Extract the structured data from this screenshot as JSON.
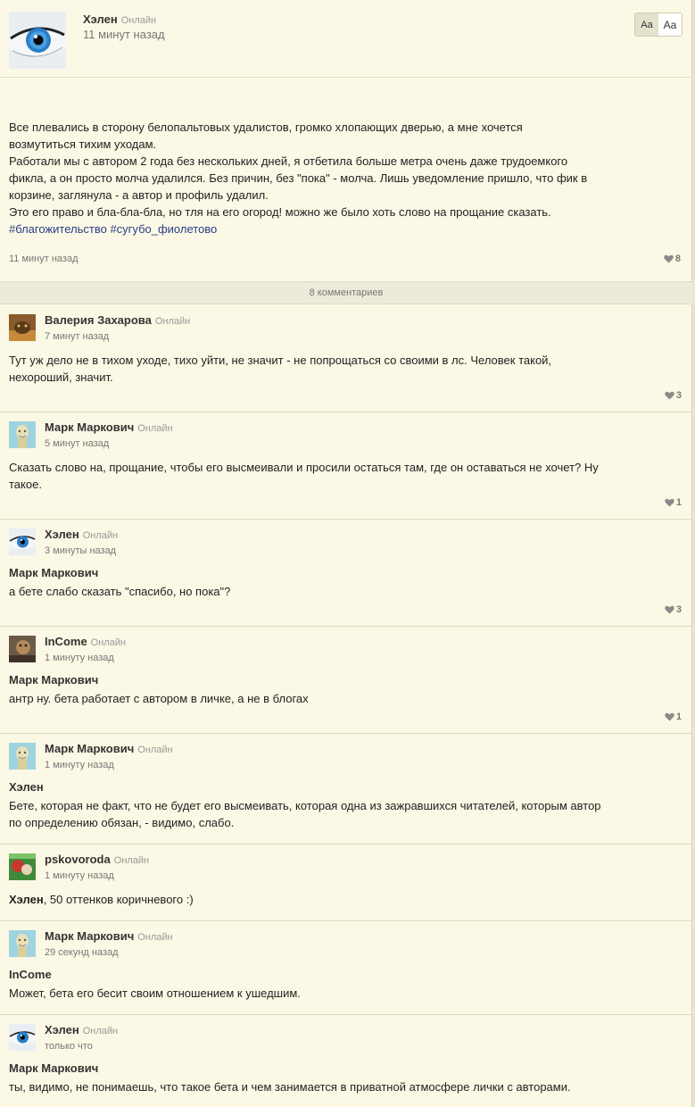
{
  "post": {
    "author": "Хэлен",
    "status": "Онлайн",
    "time": "11 минут назад",
    "font_small": "Aa",
    "font_large": "Aa",
    "lines": [
      "Все плевались в сторону белопальтовых удалистов, громко хлопающих дверью, а мне хочется",
      "возмутиться тихим уходам.",
      "Работали мы с автором 2 года без нескольких дней, я отбетила больше метра очень даже трудоемкого",
      "фикла, а он просто молча удалился. Без причин, без \"пока\" - молча. Лишь уведомление пришло, что фик в",
      "корзине, заглянула - а автор и профиль удалил.",
      "Это его право и бла-бла-бла, но тля на его огород! можно же было хоть слово на прощание сказать."
    ],
    "tags": [
      "#благожительство",
      "#сугубо_фиолетово"
    ],
    "footer_time": "11 минут назад",
    "likes": "8"
  },
  "comments_count_label": "8 комментариев",
  "comments": [
    {
      "author": "Валерия Захарова",
      "status": "Онлайн",
      "time": "7 минут назад",
      "reply_to": "",
      "lines": [
        "Тут уж дело не в тихом уходе, тихо уйти, не значит - не попрощаться со своими в лс. Человек такой,",
        "нехороший, значит."
      ],
      "likes": "3"
    },
    {
      "author": "Марк Маркович",
      "status": "Онлайн",
      "time": "5 минут назад",
      "reply_to": "",
      "lines": [
        "Сказать слово на, прощание, чтобы его высмеивали и просили остаться там, где он оставаться не хочет? Ну",
        "такое."
      ],
      "likes": "1"
    },
    {
      "author": "Хэлен",
      "status": "Онлайн",
      "time": "3 минуты назад",
      "reply_to": "Марк Маркович",
      "lines": [
        "а бете слабо сказать \"спасибо, но пока\"?"
      ],
      "likes": "3"
    },
    {
      "author": "InCome",
      "status": "Онлайн",
      "time": "1 минуту назад",
      "reply_to": "Марк Маркович",
      "lines": [
        "антр ну. бета работает с автором в личке, а не в блогах"
      ],
      "likes": "1"
    },
    {
      "author": "Марк Маркович",
      "status": "Онлайн",
      "time": "1 минуту назад",
      "reply_to": "Хэлен",
      "lines": [
        "Бете, которая не факт, что не будет его высмеивать, которая одна из зажравшихся читателей, которым автор",
        "по определению обязан, - видимо, слабо."
      ],
      "likes": ""
    },
    {
      "author": "pskovoroda",
      "status": "Онлайн",
      "time": "1 минуту назад",
      "reply_inline": "Хэлен",
      "lines": [
        ", 50 оттенков коричневого :)"
      ],
      "likes": ""
    },
    {
      "author": "Марк Маркович",
      "status": "Онлайн",
      "time": "29 секунд назад",
      "reply_to": "InCome",
      "lines": [
        "Может, бета его бесит своим отношением к ушедшим."
      ],
      "likes": ""
    },
    {
      "author": "Хэлен",
      "status": "Онлайн",
      "time": "только что",
      "reply_to": "Марк Маркович",
      "lines": [
        "ты, видимо, не понимаешь, что такое бета и чем занимается в приватной атмосфере лички с авторами."
      ],
      "likes": ""
    }
  ]
}
